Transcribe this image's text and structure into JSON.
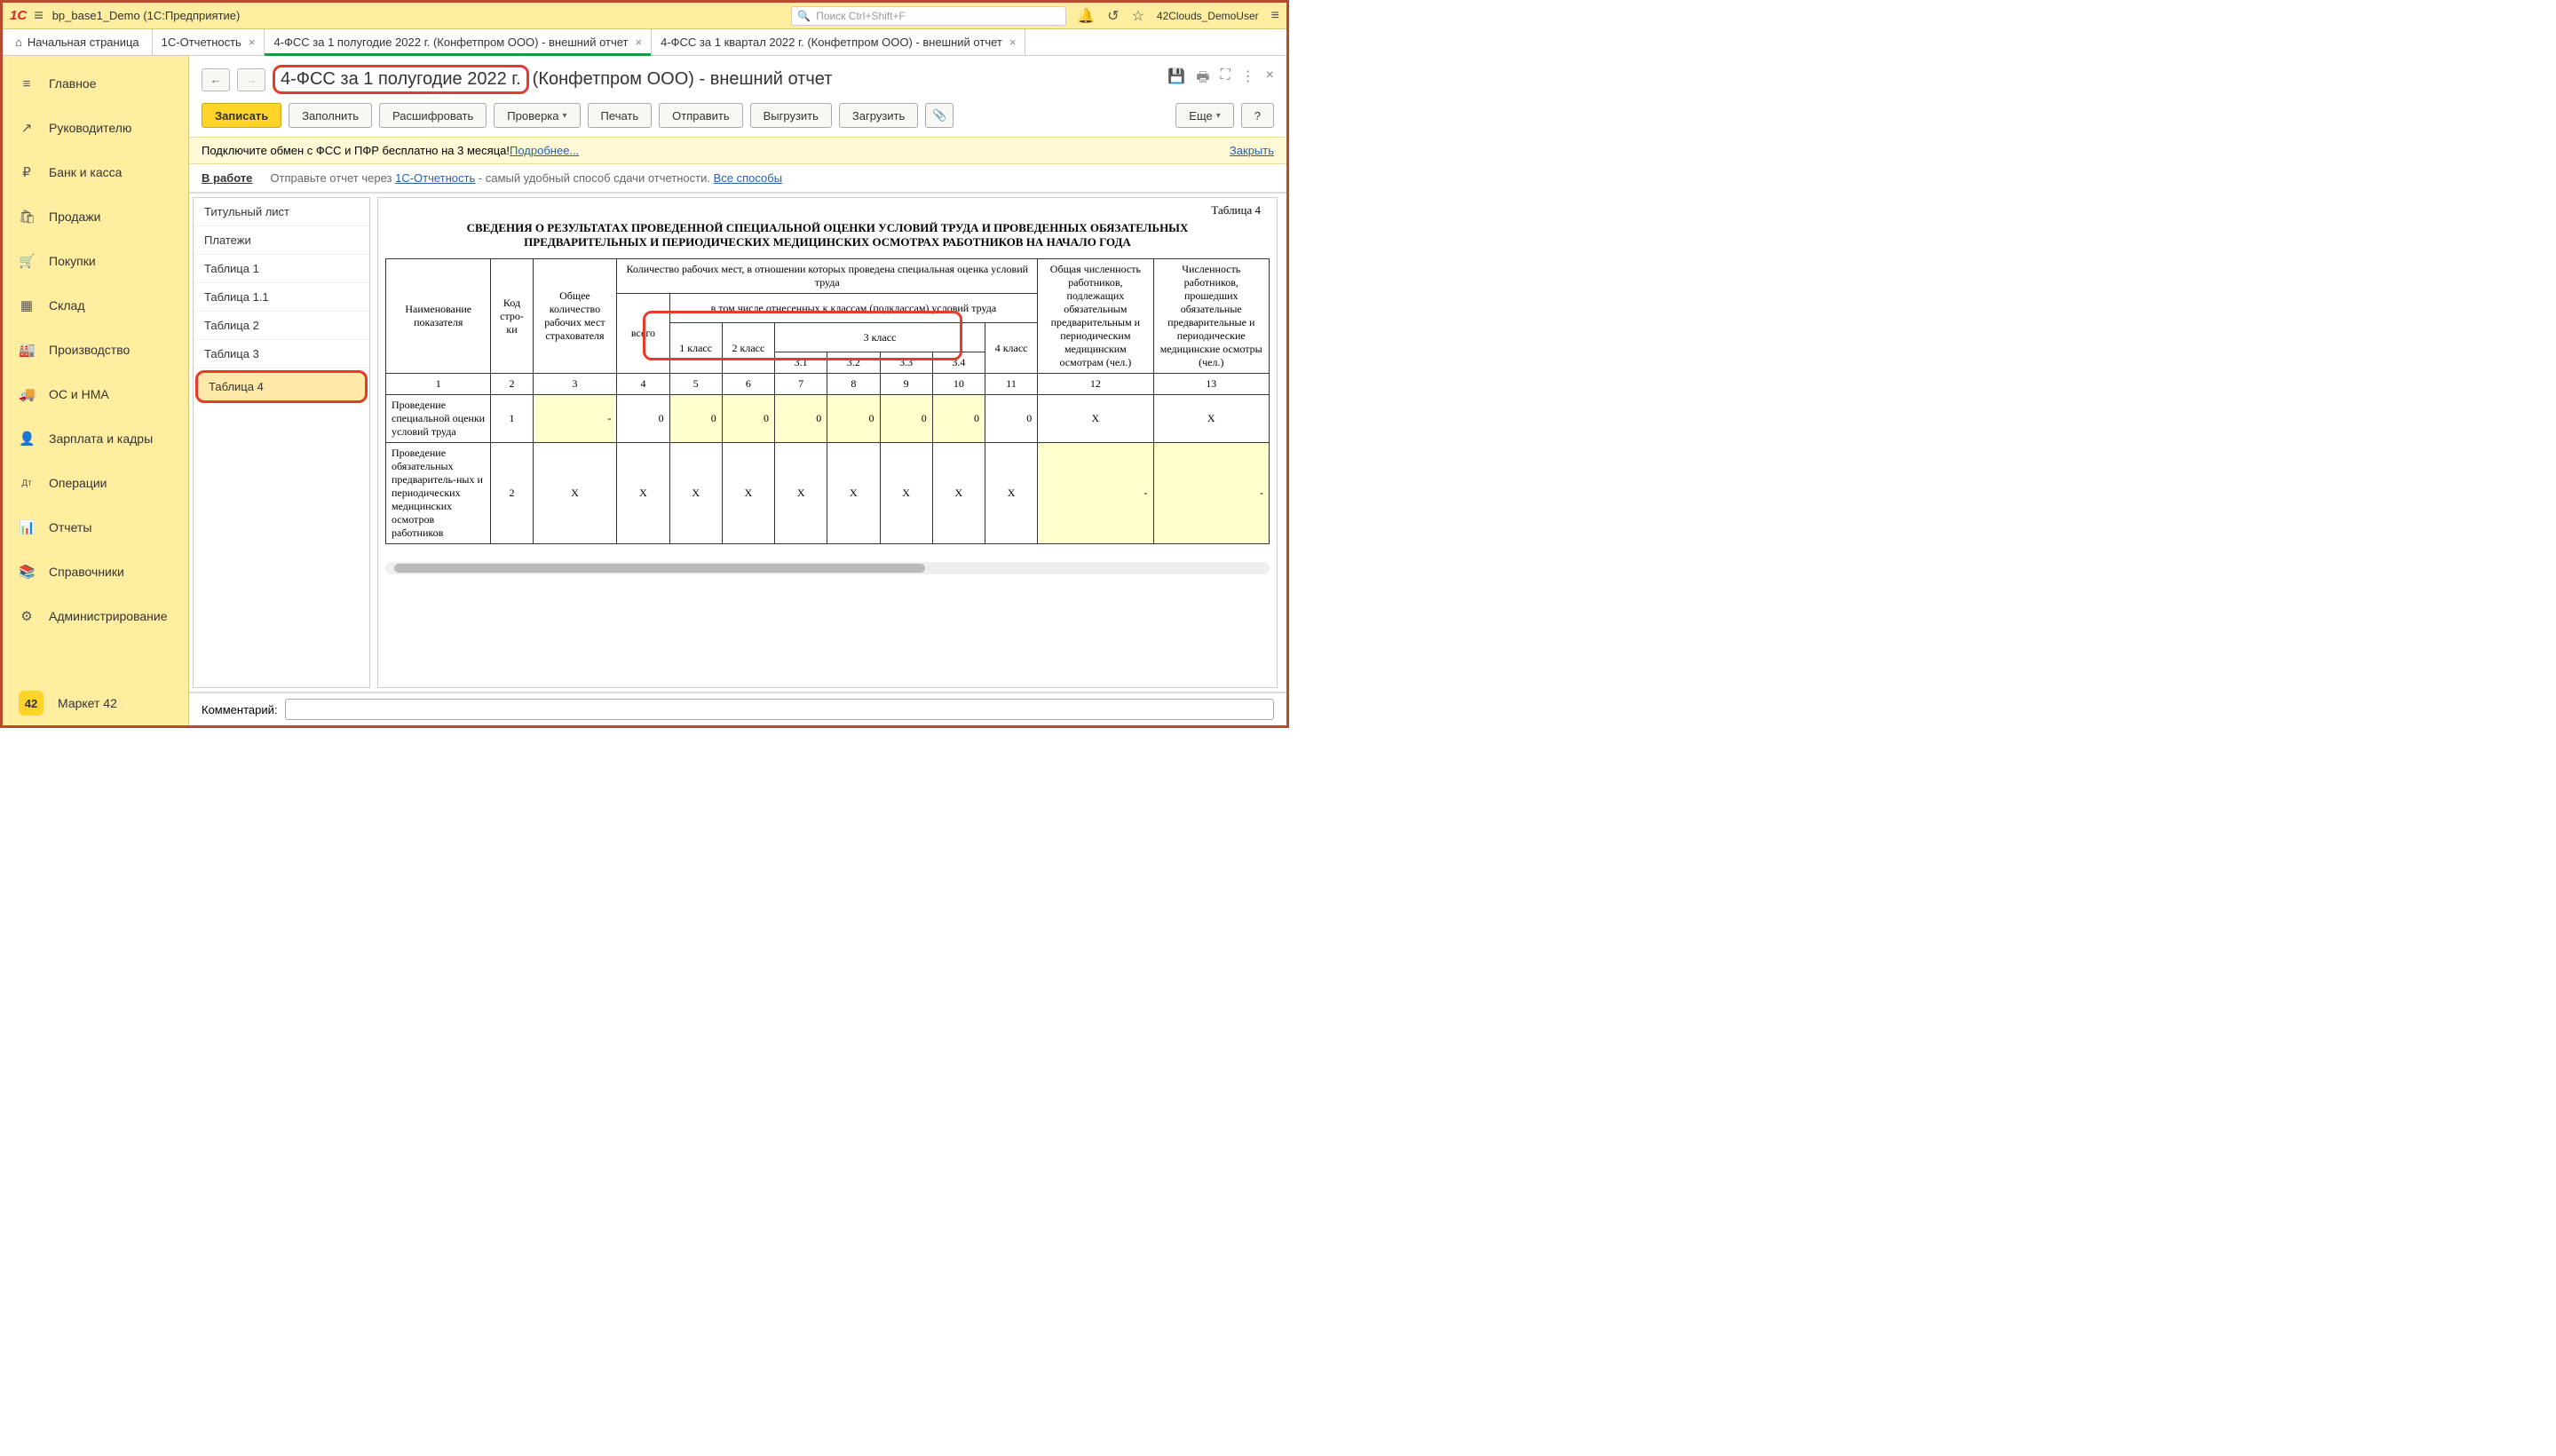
{
  "top": {
    "app_title": "bp_base1_Demo  (1С:Предприятие)",
    "search_placeholder": "Поиск Ctrl+Shift+F",
    "user": "42Clouds_DemoUser"
  },
  "tabs": {
    "home": "Начальная страница",
    "items": [
      {
        "label": "1С-Отчетность"
      },
      {
        "label": "4-ФСС за 1 полугодие 2022 г. (Конфетпром ООО) - внешний отчет",
        "active": true
      },
      {
        "label": "4-ФСС за 1 квартал 2022 г. (Конфетпром ООО) - внешний отчет"
      }
    ]
  },
  "sidebar": [
    {
      "icon": "≡",
      "label": "Главное"
    },
    {
      "icon": "↗",
      "label": "Руководителю"
    },
    {
      "icon": "₽",
      "label": "Банк и касса"
    },
    {
      "icon": "🛍",
      "label": "Продажи"
    },
    {
      "icon": "🛒",
      "label": "Покупки"
    },
    {
      "icon": "▦",
      "label": "Склад"
    },
    {
      "icon": "🏭",
      "label": "Производство"
    },
    {
      "icon": "🚚",
      "label": "ОС и НМА"
    },
    {
      "icon": "👤",
      "label": "Зарплата и кадры"
    },
    {
      "icon": "Дт",
      "label": "Операции"
    },
    {
      "icon": "📊",
      "label": "Отчеты"
    },
    {
      "icon": "📚",
      "label": "Справочники"
    },
    {
      "icon": "⚙",
      "label": "Администрирование"
    }
  ],
  "sidebar_market": "Маркет 42",
  "page": {
    "title_highlight": "4-ФСС за 1 полугодие 2022 г.",
    "title_rest": "(Конфетпром ООО) - внешний отчет"
  },
  "toolbar": {
    "save": "Записать",
    "fill": "Заполнить",
    "decode": "Расшифровать",
    "check": "Проверка",
    "print": "Печать",
    "send": "Отправить",
    "export": "Выгрузить",
    "import": "Загрузить",
    "more": "Еще",
    "help": "?"
  },
  "banner": {
    "text": "Подключите обмен с ФСС и ПФР бесплатно на 3 месяца! ",
    "link": "Подробнее...",
    "close": "Закрыть"
  },
  "status": {
    "state": "В работе",
    "text_before": "Отправьте отчет через ",
    "link1": "1С-Отчетность",
    "text_after": " - самый удобный способ сдачи отчетности. ",
    "link2": "Все способы"
  },
  "sections": [
    "Титульный лист",
    "Платежи",
    "Таблица 1",
    "Таблица 1.1",
    "Таблица 2",
    "Таблица 3",
    "Таблица 4"
  ],
  "sections_active_index": 6,
  "report": {
    "table_label": "Таблица 4",
    "title": "СВЕДЕНИЯ О РЕЗУЛЬТАТАХ ПРОВЕДЕННОЙ СПЕЦИАЛЬНОЙ ОЦЕНКИ УСЛОВИЙ ТРУДА И ПРОВЕДЕННЫХ ОБЯЗАТЕЛЬНЫХ ПРЕДВАРИТЕЛЬНЫХ И ПЕРИОДИЧЕСКИХ МЕДИЦИНСКИХ ОСМОТРАХ РАБОТНИКОВ НА НАЧАЛО ГОДА",
    "headers": {
      "name": "Наименование показателя",
      "code": "Код стро-ки",
      "total_workplaces": "Общее количество рабочих мест страхователя",
      "assessed": "Количество рабочих мест, в отношении которых проведена специальная оценка условий труда",
      "vsego": "всего",
      "byclass": "в том числе отнесенных к классам (подклассам) условий труда",
      "class1": "1 класс",
      "class2": "2 класс",
      "class3": "3 класс",
      "c31": "3.1",
      "c32": "3.2",
      "c33": "3.3",
      "c34": "3.4",
      "class4": "4 класс",
      "workers_subj": "Общая численность работников, подлежащих обязательным предварительным и периодическим медицинским осмотрам (чел.)",
      "workers_done": "Численность работников, прошедших обязательные предварительные и периодические медицинские осмотры (чел.)"
    },
    "colnums": [
      "1",
      "2",
      "3",
      "4",
      "5",
      "6",
      "7",
      "8",
      "9",
      "10",
      "11",
      "12",
      "13"
    ],
    "rows": [
      {
        "name": "Проведение специальной оценки условий труда",
        "code": "1",
        "c3": "-",
        "c4": "0",
        "c5": "0",
        "c6": "0",
        "c7": "0",
        "c8": "0",
        "c9": "0",
        "c10": "0",
        "c11": "0",
        "c12": "X",
        "c13": "X"
      },
      {
        "name": "Проведение обязательных предваритель-ных и периодических медицинских осмотров работников",
        "code": "2",
        "c3": "X",
        "c4": "X",
        "c5": "X",
        "c6": "X",
        "c7": "X",
        "c8": "X",
        "c9": "X",
        "c10": "X",
        "c11": "X",
        "c12": "-",
        "c13": "-"
      }
    ]
  },
  "comment_label": "Комментарий:"
}
